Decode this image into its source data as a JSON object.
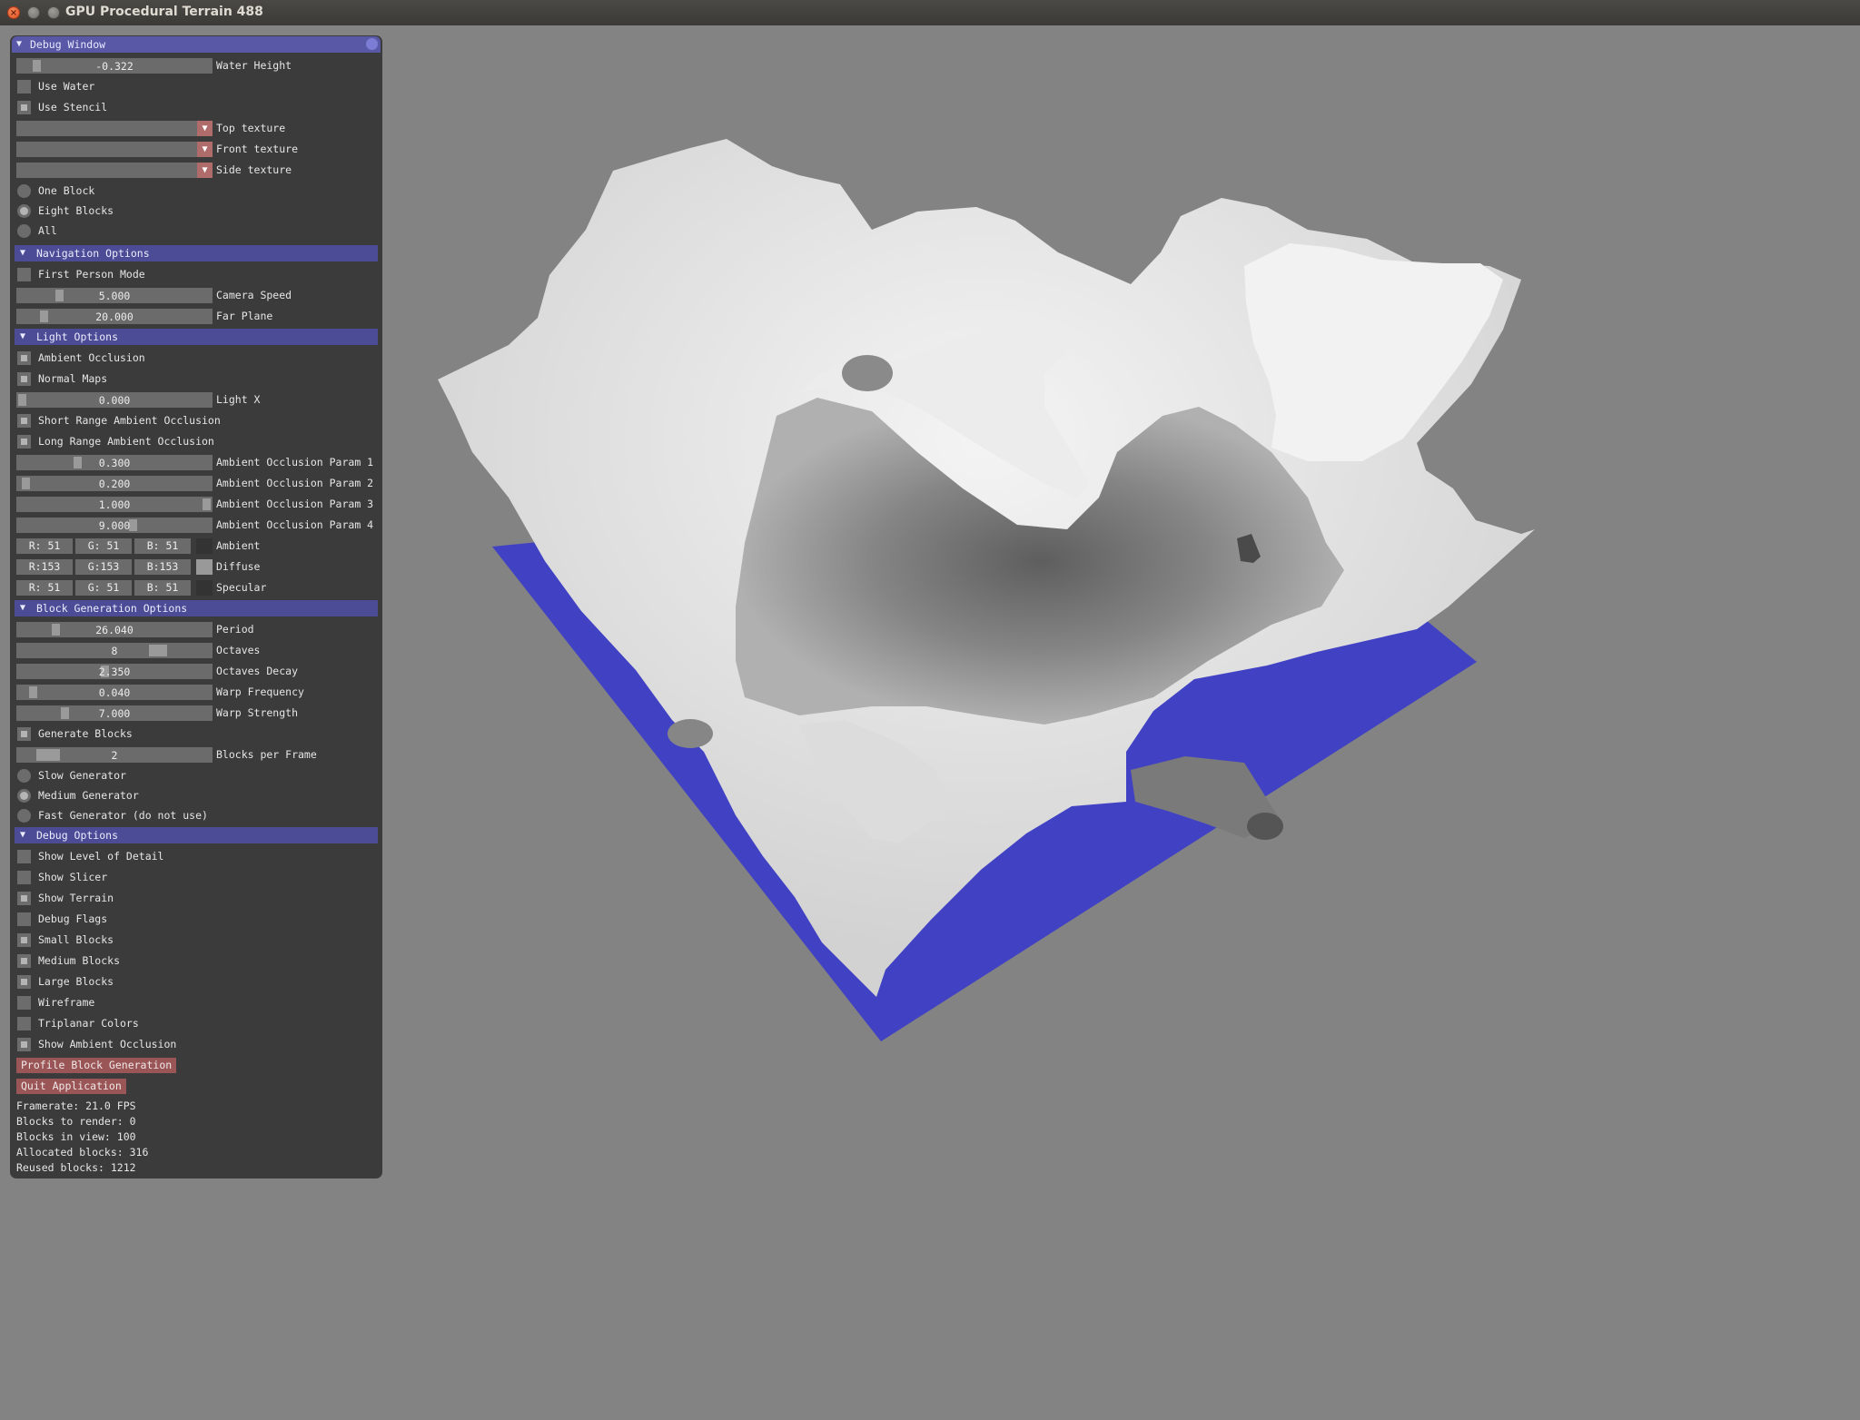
{
  "window": {
    "title": "GPU Procedural Terrain 488",
    "close_glyph": "×"
  },
  "colors": {
    "background": "#838383",
    "water": "#4141c4",
    "panel": "#383838",
    "header": "#4b4b96",
    "button": "#9a5656"
  },
  "panel": {
    "title": "Debug Window",
    "top": {
      "water_height": {
        "value": "-0.322",
        "label": "Water Height",
        "level": 0.08
      },
      "use_water": {
        "label": "Use Water",
        "checked": false
      },
      "use_stencil": {
        "label": "Use Stencil",
        "checked": true
      },
      "top_texture": {
        "label": "Top texture",
        "value": ""
      },
      "front_texture": {
        "label": "Front texture",
        "value": ""
      },
      "side_texture": {
        "label": "Side texture",
        "value": ""
      },
      "one_block": {
        "label": "One Block",
        "selected": false
      },
      "eight_blocks": {
        "label": "Eight Blocks",
        "selected": true
      },
      "all": {
        "label": "All",
        "selected": false
      }
    },
    "navigation": {
      "header": "Navigation Options",
      "first_person": {
        "label": "First Person Mode",
        "checked": false
      },
      "camera_speed": {
        "value": "5.000",
        "label": "Camera Speed",
        "level": 0.2
      },
      "far_plane": {
        "value": "20.000",
        "label": "Far Plane",
        "level": 0.12
      }
    },
    "light": {
      "header": "Light Options",
      "ambient_occlusion": {
        "label": "Ambient Occlusion",
        "checked": true
      },
      "normal_maps": {
        "label": "Normal Maps",
        "checked": true
      },
      "light_x": {
        "value": "0.000",
        "label": "Light X",
        "level": 0.0
      },
      "short_range_ao": {
        "label": "Short Range Ambient Occlusion",
        "checked": true
      },
      "long_range_ao": {
        "label": "Long Range Ambient Occlusion",
        "checked": true
      },
      "ao_param_1": {
        "value": "0.300",
        "label": "Ambient Occlusion Param 1",
        "level": 0.3
      },
      "ao_param_2": {
        "value": "0.200",
        "label": "Ambient Occlusion Param 2",
        "level": 0.02
      },
      "ao_param_3": {
        "value": "1.000",
        "label": "Ambient Occlusion Param 3",
        "level": 1.0
      },
      "ao_param_4": {
        "value": "9.000",
        "label": "Ambient Occlusion Param 4",
        "level": 0.6
      },
      "ambient": {
        "label": "Ambient",
        "r": "R: 51",
        "g": "G: 51",
        "b": "B: 51",
        "color": "#333333"
      },
      "diffuse": {
        "label": "Diffuse",
        "r": "R:153",
        "g": "G:153",
        "b": "B:153",
        "color": "#999999"
      },
      "specular": {
        "label": "Specular",
        "r": "R: 51",
        "g": "G: 51",
        "b": "B: 51",
        "color": "#333333"
      }
    },
    "block_gen": {
      "header": "Block Generation Options",
      "period": {
        "value": "26.040",
        "label": "Period",
        "level": 0.18
      },
      "octaves": {
        "value": "8",
        "label": "Octaves",
        "level": 0.75
      },
      "octaves_decay": {
        "value": "2.350",
        "label": "Octaves Decay",
        "level": 0.45
      },
      "warp_frequency": {
        "value": "0.040",
        "label": "Warp Frequency",
        "level": 0.06
      },
      "warp_strength": {
        "value": "7.000",
        "label": "Warp Strength",
        "level": 0.23
      },
      "generate_blocks": {
        "label": "Generate Blocks",
        "checked": true
      },
      "blocks_per_frame": {
        "value": "2",
        "label": "Blocks per Frame",
        "level": 0.11
      },
      "slow_generator": {
        "label": "Slow Generator",
        "selected": false
      },
      "medium_generator": {
        "label": "Medium Generator",
        "selected": true
      },
      "fast_generator": {
        "label": "Fast Generator (do not use)",
        "selected": false
      }
    },
    "debug": {
      "header": "Debug Options",
      "show_lod": {
        "label": "Show Level of Detail",
        "checked": false
      },
      "show_slicer": {
        "label": "Show Slicer",
        "checked": false
      },
      "show_terrain": {
        "label": "Show Terrain",
        "checked": true
      },
      "debug_flags": {
        "label": "Debug Flags",
        "checked": false
      },
      "small_blocks": {
        "label": "Small Blocks",
        "checked": true
      },
      "medium_blocks": {
        "label": "Medium Blocks",
        "checked": true
      },
      "large_blocks": {
        "label": "Large Blocks",
        "checked": true
      },
      "wireframe": {
        "label": "Wireframe",
        "checked": false
      },
      "triplanar_colors": {
        "label": "Triplanar Colors",
        "checked": false
      },
      "show_ao": {
        "label": "Show Ambient Occlusion",
        "checked": true
      },
      "profile_button": "Profile Block Generation",
      "quit_button": "Quit Application"
    },
    "stats": {
      "framerate": "Framerate: 21.0 FPS",
      "blocks_to_render": "Blocks to render: 0",
      "blocks_in_view": "Blocks in view: 100",
      "allocated_blocks": "Allocated blocks: 316",
      "reused_blocks": "Reused blocks: 1212"
    }
  }
}
